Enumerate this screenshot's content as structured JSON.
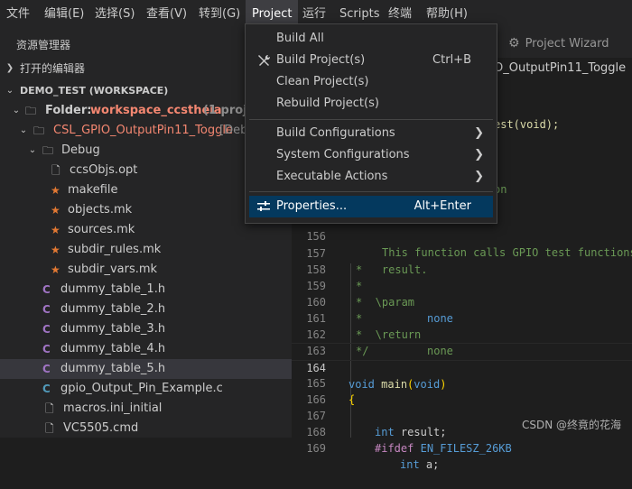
{
  "menubar": [
    "文件",
    "编辑(E)",
    "选择(S)",
    "查看(V)",
    "转到(G)",
    "Project",
    "运行",
    "Scripts",
    "终端",
    "帮助(H)"
  ],
  "sidebar": {
    "title": "资源管理器",
    "open_editors": "打开的编辑器",
    "workspace": "DEMO_TEST (WORKSPACE)",
    "folder_label": "Folder:",
    "folder_name": "workspace_ccstheia",
    "folder_suffix": "(1 proje",
    "project": "CSL_GPIO_OutputPin11_Toggle",
    "project_suffix": "[Deb",
    "debug_folder": "Debug",
    "debug_files": [
      "ccsObjs.opt",
      "makefile",
      "objects.mk",
      "sources.mk",
      "subdir_rules.mk",
      "subdir_vars.mk"
    ],
    "c_files": [
      "dummy_table_1.h",
      "dummy_table_2.h",
      "dummy_table_3.h",
      "dummy_table_4.h",
      "dummy_table_5.h",
      "gpio_Output_Pin_Example.c"
    ],
    "macros": "macros.ini_initial",
    "cmd": "VC5505.cmd",
    "file_icon_letter": "C"
  },
  "editor": {
    "tab_project_wizard": "Project Wizard",
    "breadcrumb": "O_OutputPin11_Toggle",
    "frag_test": "est(void);",
    "frag_on": "on",
    "frag_desc": "This function calls GPIO test functions",
    "lines": {
      "n156": "156",
      "n157": "157",
      "n158": "158",
      "n159": "159",
      "n160": "160",
      "n161": "161",
      "n162": "162",
      "n163": "163",
      "n164": "164",
      "n165": "165",
      "n166": "166",
      "n167": "167",
      "n168": "168",
      "n169": "169",
      "c157": "*   result.",
      "c158": "*",
      "c159_a": "*  \\param",
      "c159_b": "none",
      "c160": "*",
      "c161_a": "*  \\return",
      "c161_b": "none",
      "c162": "*/",
      "c164_kw": "void",
      "c164_fn": "main",
      "c164_p1": "(",
      "c164_kw2": "void",
      "c164_p2": ")",
      "c165": "{",
      "c167_kw": "int",
      "c167_rest": "result;",
      "c168_pp": "#ifdef",
      "c168_mac": "EN_FILESZ_26KB",
      "c169_kw": "int",
      "c169_rest": "a;"
    }
  },
  "context_menu": {
    "build_all": "Build All",
    "build_projects": "Build Project(s)",
    "build_projects_key": "Ctrl+B",
    "clean_projects": "Clean Project(s)",
    "rebuild_projects": "Rebuild Project(s)",
    "build_configurations": "Build Configurations",
    "system_configurations": "System Configurations",
    "executable_actions": "Executable Actions",
    "properties": "Properties...",
    "properties_key": "Alt+Enter"
  },
  "watermark": "CSDN @终竟的花海"
}
